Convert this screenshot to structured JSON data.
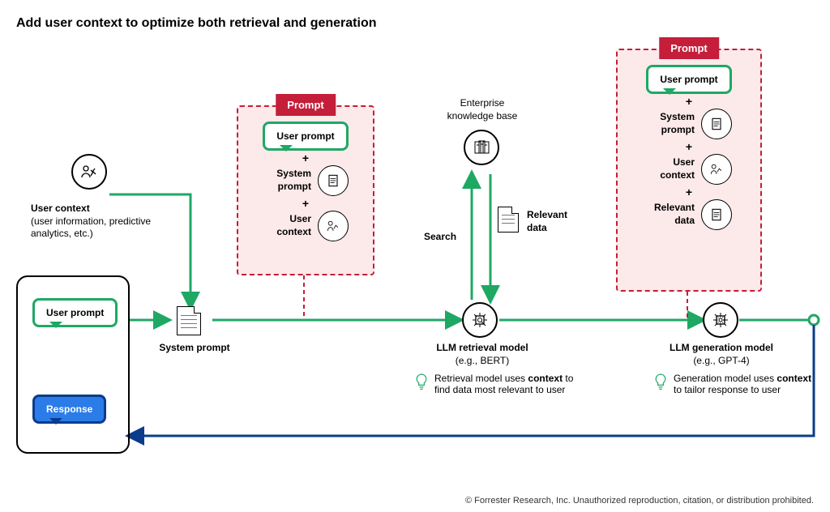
{
  "title": "Add user context to optimize both retrieval and generation",
  "userContext": {
    "heading": "User context",
    "sub": "(user information, predictive analytics, etc.)"
  },
  "device": {
    "userPrompt": "User prompt",
    "response": "Response"
  },
  "systemPrompt": "System prompt",
  "promptPanel1": {
    "tag": "Prompt",
    "userPrompt": "User prompt",
    "row1": "System prompt",
    "row2": "User context"
  },
  "ekb": "Enterprise knowledge base",
  "searchLabel": "Search",
  "relevantData": "Relevant data",
  "retrieval": {
    "name": "LLM retrieval model",
    "sub": "(e.g., BERT)",
    "note_pre": "Retrieval model uses ",
    "note_bold": "context",
    "note_post": " to find data most relevant to user"
  },
  "promptPanel2": {
    "tag": "Prompt",
    "userPrompt": "User prompt",
    "row1": "System prompt",
    "row2": "User context",
    "row3": "Relevant data"
  },
  "generation": {
    "name": "LLM generation model",
    "sub": "(e.g., GPT-4)",
    "note_pre": "Generation model uses ",
    "note_bold": "context",
    "note_post": " to tailor response to user"
  },
  "copyright": "© Forrester Research, Inc. Unauthorized reproduction, citation, or distribution prohibited."
}
